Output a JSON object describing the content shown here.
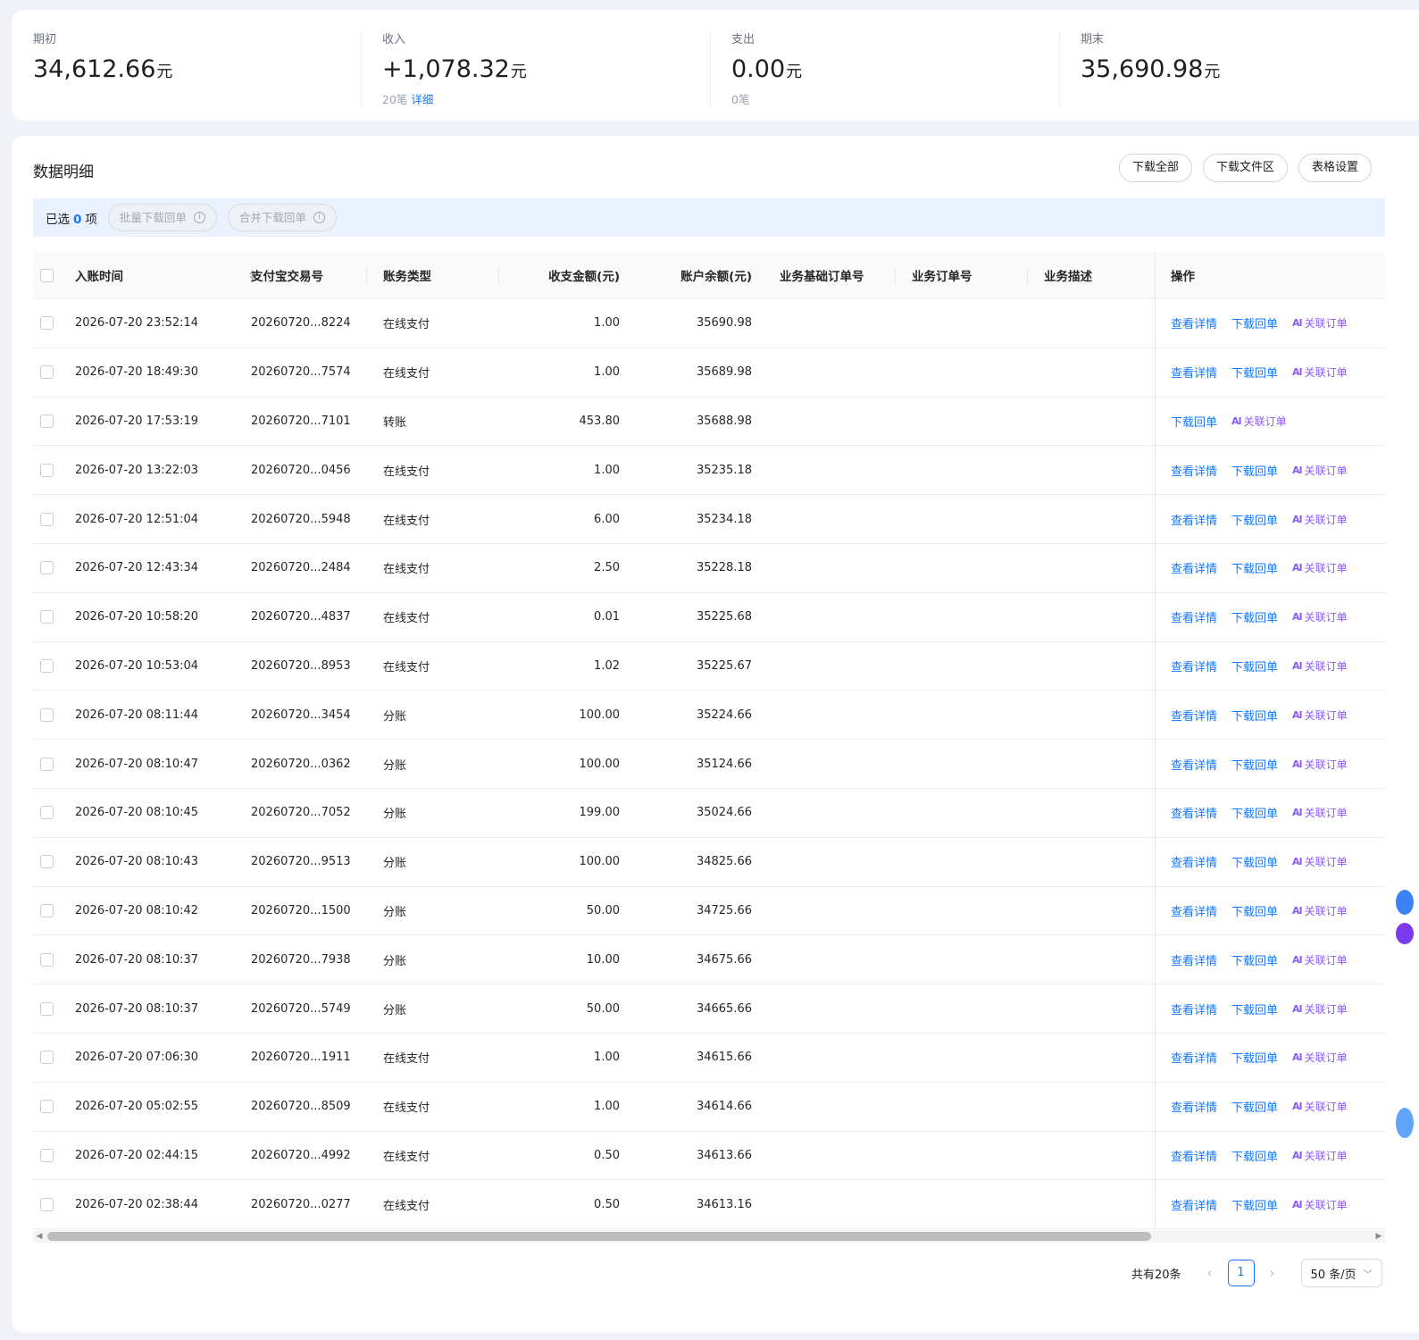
{
  "summary": [
    {
      "label": "期初",
      "value": "34,612.66",
      "unit": "元",
      "count": "",
      "link": ""
    },
    {
      "label": "收入",
      "value": "+1,078.32",
      "unit": "元",
      "count": "20笔",
      "link": "详细"
    },
    {
      "label": "支出",
      "value": "0.00",
      "unit": "元",
      "count": "0笔",
      "link": ""
    },
    {
      "label": "期末",
      "value": "35,690.98",
      "unit": "元",
      "count": "",
      "link": ""
    }
  ],
  "detail": {
    "title": "数据明细",
    "buttons": {
      "download_all": "下载全部",
      "download_area": "下载文件区",
      "table_settings": "表格设置"
    }
  },
  "selection": {
    "prefix": "已选",
    "count": "0",
    "suffix": "项",
    "batch_download": "批量下载回单",
    "merge_download": "合并下载回单"
  },
  "columns": {
    "time": "入账时间",
    "trade_no": "支付宝交易号",
    "type": "账务类型",
    "amount": "收支金额(元)",
    "balance": "账户余额(元)",
    "base_order": "业务基础订单号",
    "order": "业务订单号",
    "desc": "业务描述",
    "ops": "操作"
  },
  "actions": {
    "view": "查看详情",
    "download": "下载回单",
    "ai_glyph": "AI",
    "link_order": "关联订单"
  },
  "rows": [
    {
      "time": "2026-07-20 23:52:14",
      "trade_no": "20260720...8224",
      "type": "在线支付",
      "amount": "1.00",
      "balance": "35690.98",
      "has_view": true
    },
    {
      "time": "2026-07-20 18:49:30",
      "trade_no": "20260720...7574",
      "type": "在线支付",
      "amount": "1.00",
      "balance": "35689.98",
      "has_view": true
    },
    {
      "time": "2026-07-20 17:53:19",
      "trade_no": "20260720...7101",
      "type": "转账",
      "amount": "453.80",
      "balance": "35688.98",
      "has_view": false
    },
    {
      "time": "2026-07-20 13:22:03",
      "trade_no": "20260720...0456",
      "type": "在线支付",
      "amount": "1.00",
      "balance": "35235.18",
      "has_view": true
    },
    {
      "time": "2026-07-20 12:51:04",
      "trade_no": "20260720...5948",
      "type": "在线支付",
      "amount": "6.00",
      "balance": "35234.18",
      "has_view": true
    },
    {
      "time": "2026-07-20 12:43:34",
      "trade_no": "20260720...2484",
      "type": "在线支付",
      "amount": "2.50",
      "balance": "35228.18",
      "has_view": true
    },
    {
      "time": "2026-07-20 10:58:20",
      "trade_no": "20260720...4837",
      "type": "在线支付",
      "amount": "0.01",
      "balance": "35225.68",
      "has_view": true
    },
    {
      "time": "2026-07-20 10:53:04",
      "trade_no": "20260720...8953",
      "type": "在线支付",
      "amount": "1.02",
      "balance": "35225.67",
      "has_view": true
    },
    {
      "time": "2026-07-20 08:11:44",
      "trade_no": "20260720...3454",
      "type": "分账",
      "amount": "100.00",
      "balance": "35224.66",
      "has_view": true
    },
    {
      "time": "2026-07-20 08:10:47",
      "trade_no": "20260720...0362",
      "type": "分账",
      "amount": "100.00",
      "balance": "35124.66",
      "has_view": true
    },
    {
      "time": "2026-07-20 08:10:45",
      "trade_no": "20260720...7052",
      "type": "分账",
      "amount": "199.00",
      "balance": "35024.66",
      "has_view": true
    },
    {
      "time": "2026-07-20 08:10:43",
      "trade_no": "20260720...9513",
      "type": "分账",
      "amount": "100.00",
      "balance": "34825.66",
      "has_view": true
    },
    {
      "time": "2026-07-20 08:10:42",
      "trade_no": "20260720...1500",
      "type": "分账",
      "amount": "50.00",
      "balance": "34725.66",
      "has_view": true
    },
    {
      "time": "2026-07-20 08:10:37",
      "trade_no": "20260720...7938",
      "type": "分账",
      "amount": "10.00",
      "balance": "34675.66",
      "has_view": true
    },
    {
      "time": "2026-07-20 08:10:37",
      "trade_no": "20260720...5749",
      "type": "分账",
      "amount": "50.00",
      "balance": "34665.66",
      "has_view": true
    },
    {
      "time": "2026-07-20 07:06:30",
      "trade_no": "20260720...1911",
      "type": "在线支付",
      "amount": "1.00",
      "balance": "34615.66",
      "has_view": true
    },
    {
      "time": "2026-07-20 05:02:55",
      "trade_no": "20260720...8509",
      "type": "在线支付",
      "amount": "1.00",
      "balance": "34614.66",
      "has_view": true
    },
    {
      "time": "2026-07-20 02:44:15",
      "trade_no": "20260720...4992",
      "type": "在线支付",
      "amount": "0.50",
      "balance": "34613.66",
      "has_view": true
    },
    {
      "time": "2026-07-20 02:38:44",
      "trade_no": "20260720...0277",
      "type": "在线支付",
      "amount": "0.50",
      "balance": "34613.16",
      "has_view": true
    }
  ],
  "pagination": {
    "total": "共有20条",
    "current": "1",
    "page_size": "50 条/页",
    "prev": "‹",
    "next": "›"
  },
  "colors": {
    "accent": "#1677ff",
    "ai": "#8b5cf6",
    "page_bg": "#f0f2f7"
  }
}
